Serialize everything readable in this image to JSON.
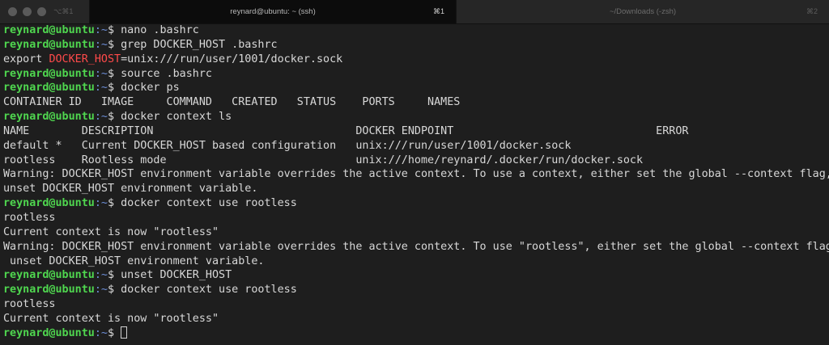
{
  "titlebar": {
    "left_shortcut": "⌥⌘1",
    "tabs": [
      {
        "title": "reynard@ubuntu: ~ (ssh)",
        "shortcut": "⌘1"
      },
      {
        "title": "~/Downloads (-zsh)",
        "shortcut": "⌘2"
      }
    ]
  },
  "colors": {
    "user": "#4fd64f",
    "path": "#6d8fd8",
    "highlight": "#ff4a4a",
    "text": "#d8d8d8",
    "background": "#1e1e1e"
  },
  "terminal": {
    "prompt_user": "reynard@ubuntu",
    "prompt_path": ":~",
    "prompt_symbol": "$ ",
    "lines": [
      {
        "type": "prompt",
        "text": "nano .bashrc"
      },
      {
        "type": "prompt",
        "text": "grep DOCKER_HOST .bashrc"
      },
      {
        "type": "export",
        "prefix": "export ",
        "highlight": "DOCKER_HOST",
        "suffix": "=unix:///run/user/1001/docker.sock"
      },
      {
        "type": "prompt",
        "text": "source .bashrc"
      },
      {
        "type": "prompt",
        "text": "docker ps"
      },
      {
        "type": "output",
        "text": "CONTAINER ID   IMAGE     COMMAND   CREATED   STATUS    PORTS     NAMES"
      },
      {
        "type": "prompt",
        "text": "docker context ls"
      },
      {
        "type": "output",
        "text": "NAME        DESCRIPTION                               DOCKER ENDPOINT                               ERROR"
      },
      {
        "type": "output",
        "text": "default *   Current DOCKER_HOST based configuration   unix:///run/user/1001/docker.sock"
      },
      {
        "type": "output",
        "text": "rootless    Rootless mode                             unix:///home/reynard/.docker/run/docker.sock"
      },
      {
        "type": "output",
        "text": "Warning: DOCKER_HOST environment variable overrides the active context. To use a context, either set the global --context flag, or"
      },
      {
        "type": "output",
        "text": "unset DOCKER_HOST environment variable."
      },
      {
        "type": "prompt",
        "text": "docker context use rootless"
      },
      {
        "type": "output",
        "text": "rootless"
      },
      {
        "type": "output",
        "text": "Current context is now \"rootless\""
      },
      {
        "type": "output",
        "text": "Warning: DOCKER_HOST environment variable overrides the active context. To use \"rootless\", either set the global --context flag, or"
      },
      {
        "type": "output",
        "text": " unset DOCKER_HOST environment variable."
      },
      {
        "type": "prompt",
        "text": "unset DOCKER_HOST"
      },
      {
        "type": "prompt",
        "text": "docker context use rootless"
      },
      {
        "type": "output",
        "text": "rootless"
      },
      {
        "type": "output",
        "text": "Current context is now \"rootless\""
      },
      {
        "type": "cursor",
        "text": ""
      }
    ]
  }
}
